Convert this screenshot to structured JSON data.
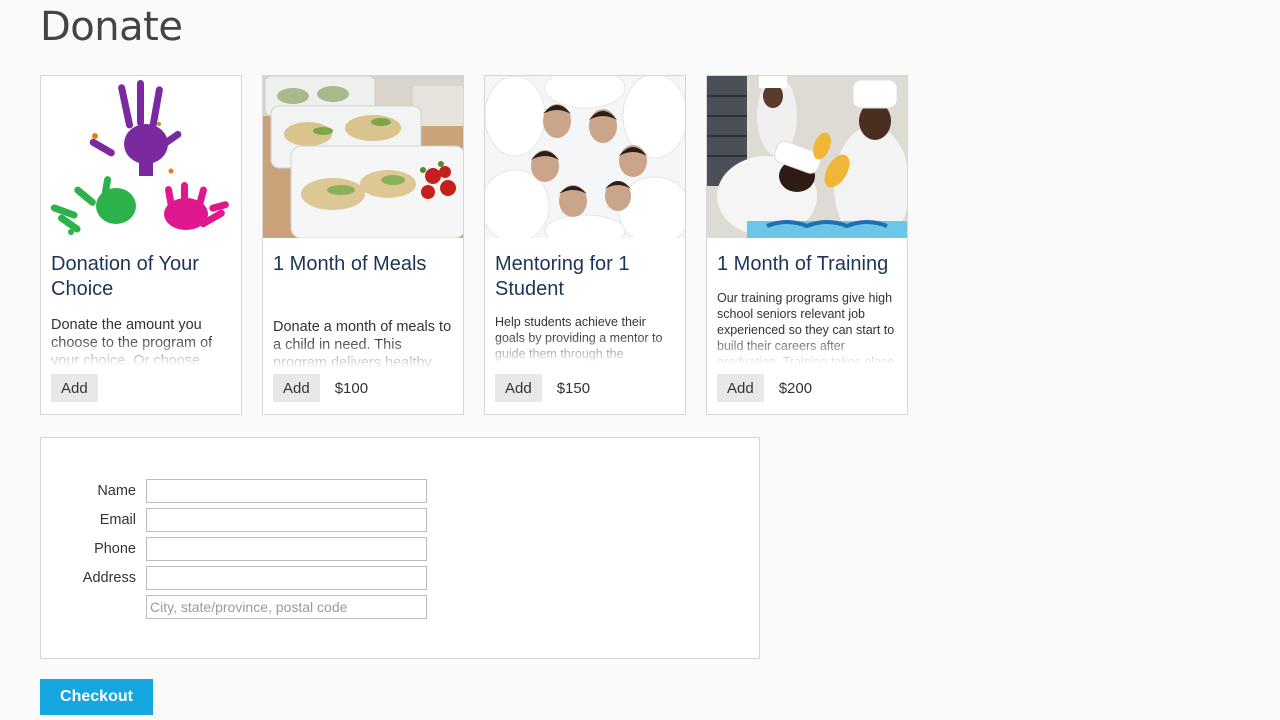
{
  "page": {
    "title": "Donate"
  },
  "cards": [
    {
      "title": "Donation of Your Choice",
      "description": "Donate the amount you choose to the program of your choice. Or choose",
      "add_label": "Add",
      "price": "",
      "image": "children-painted-handprints"
    },
    {
      "title": "1 Month of Meals",
      "description": "Donate a month of meals to a child in need. This program delivers healthy",
      "add_label": "Add",
      "price": "$100",
      "image": "packed-lunch-containers"
    },
    {
      "title": "Mentoring for 1 Student",
      "description": "Help students achieve their goals by providing a mentor to guide them through the",
      "add_label": "Add",
      "price": "$150",
      "image": "students-circle-looking-down"
    },
    {
      "title": "1 Month of Training",
      "description": "Our training programs give high school seniors relevant job experienced so they can start to build their careers after graduation. Training takes place",
      "add_label": "Add",
      "price": "$200",
      "image": "culinary-trainees-decorating-cake"
    }
  ],
  "form": {
    "name_label": "Name",
    "email_label": "Email",
    "phone_label": "Phone",
    "address_label": "Address",
    "name_value": "",
    "email_value": "",
    "phone_value": "",
    "address_value": "",
    "city_placeholder": "City, state/province, postal code"
  },
  "checkout_label": "Checkout",
  "colors": {
    "accent": "#16a7e0",
    "title_text": "#1c3557",
    "add_button_bg": "#e8e8e8"
  }
}
